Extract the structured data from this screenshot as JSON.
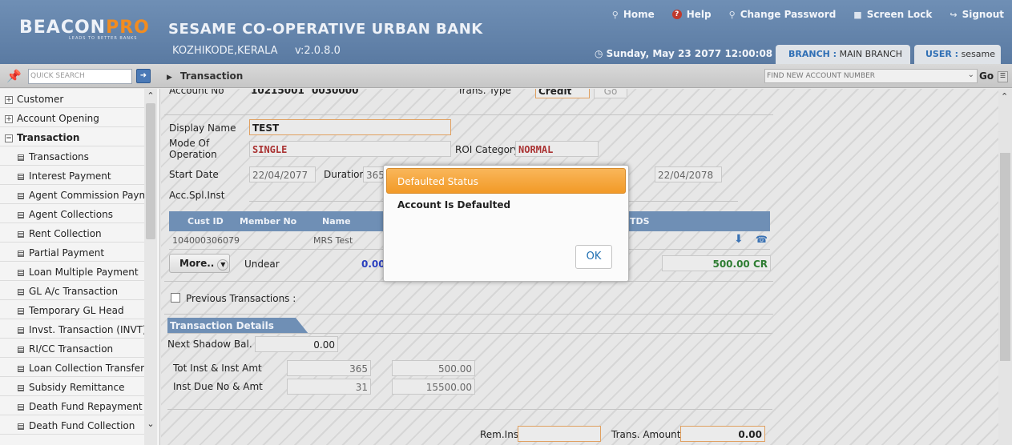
{
  "header": {
    "logo_main": "BEACON",
    "logo_accent": "PRO",
    "logo_tagline": "LEADS TO BETTER BANKS",
    "bank_name": "SESAME CO-OPERATIVE URBAN BANK",
    "location": "KOZHIKODE,KERALA",
    "version": "v:2.0.8.0",
    "links": {
      "home": "Home",
      "help": "Help",
      "change_password": "Change Password",
      "screen_lock": "Screen Lock",
      "signout": "Signout"
    },
    "datetime": "Sunday, May 23 2077 12:00:08 PM",
    "branch_key": "BRANCH :",
    "branch_val": "MAIN BRANCH",
    "user_key": "USER :",
    "user_val": "sesame"
  },
  "toolbar": {
    "quick_search_placeholder": "QUICK SEARCH",
    "breadcrumb": "Transaction",
    "account_search_placeholder": "FIND NEW ACCOUNT NUMBER",
    "go_label": "Go"
  },
  "sidebar": {
    "items": [
      {
        "label": "Customer",
        "kind": "group",
        "sign": "+"
      },
      {
        "label": "Account Opening",
        "kind": "group",
        "sign": "+"
      },
      {
        "label": "Transaction",
        "kind": "group-open",
        "sign": "−"
      },
      {
        "label": "Transactions",
        "kind": "sub"
      },
      {
        "label": "Interest Payment",
        "kind": "sub"
      },
      {
        "label": "Agent Commission Payment",
        "kind": "sub"
      },
      {
        "label": "Agent Collections",
        "kind": "sub"
      },
      {
        "label": "Rent Collection",
        "kind": "sub"
      },
      {
        "label": "Partial Payment",
        "kind": "sub"
      },
      {
        "label": "Loan Multiple Payment",
        "kind": "sub"
      },
      {
        "label": "GL A/c Transaction",
        "kind": "sub"
      },
      {
        "label": "Temporary GL Head",
        "kind": "sub"
      },
      {
        "label": "Invst. Transaction (INVT)",
        "kind": "sub"
      },
      {
        "label": "RI/CC Transaction",
        "kind": "sub"
      },
      {
        "label": "Loan Collection Transfer",
        "kind": "sub"
      },
      {
        "label": "Subsidy Remittance",
        "kind": "sub"
      },
      {
        "label": "Death Fund Repayment",
        "kind": "sub"
      },
      {
        "label": "Death Fund Collection",
        "kind": "sub"
      }
    ]
  },
  "form": {
    "account_no_label": "Account No",
    "account_no_1": "10215001",
    "account_no_2": "0030000",
    "trans_type_label": "Trans. Type",
    "trans_type_value": "Credit",
    "go_button": "Go",
    "display_name_label": "Display Name",
    "display_name_value": "TEST",
    "mode_label_1": "Mode Of",
    "mode_label_2": "Operation",
    "mode_value": "SINGLE",
    "roi_label": "ROI Category",
    "roi_value": "NORMAL",
    "start_date_label": "Start Date",
    "start_date_value": "22/04/2077",
    "duration_label": "Duration",
    "duration_value": "365",
    "end_date_value": "22/04/2078",
    "acc_spl_label": "Acc.Spl.Inst",
    "grid_headers": {
      "cust_id": "Cust ID",
      "member_no": "Member No",
      "name": "Name",
      "tds": "TDS"
    },
    "grid_row": {
      "cust_id": "104000306079",
      "member_no": "",
      "name": "MRS Test"
    },
    "more_button": "More..",
    "undear_label": "Undear",
    "undear_value": "0.00",
    "balance_value": "500.00 CR",
    "prev_txn_label": "Previous Transactions :",
    "txn_details_title": "Transaction Details",
    "next_shadow_label": "Next Shadow Bal.",
    "next_shadow_value": "0.00",
    "tot_inst_label": "Tot Inst & Inst Amt",
    "tot_inst_no": "365",
    "tot_inst_amt": "500.00",
    "inst_due_label": "Inst Due No & Amt",
    "inst_due_no": "31",
    "inst_due_amt": "15500.00",
    "rem_inst_label": "Rem.Inst",
    "trans_amount_label": "Trans. Amount",
    "trans_amount_value": "0.00"
  },
  "modal": {
    "title": "Defaulted Status",
    "message": "Account Is Defaulted",
    "ok_label": "OK"
  },
  "colors": {
    "header": "#6f8fb5",
    "accent_orange": "#f29a27",
    "link_blue": "#1f6fb2",
    "credit_green": "#2e7d32"
  }
}
